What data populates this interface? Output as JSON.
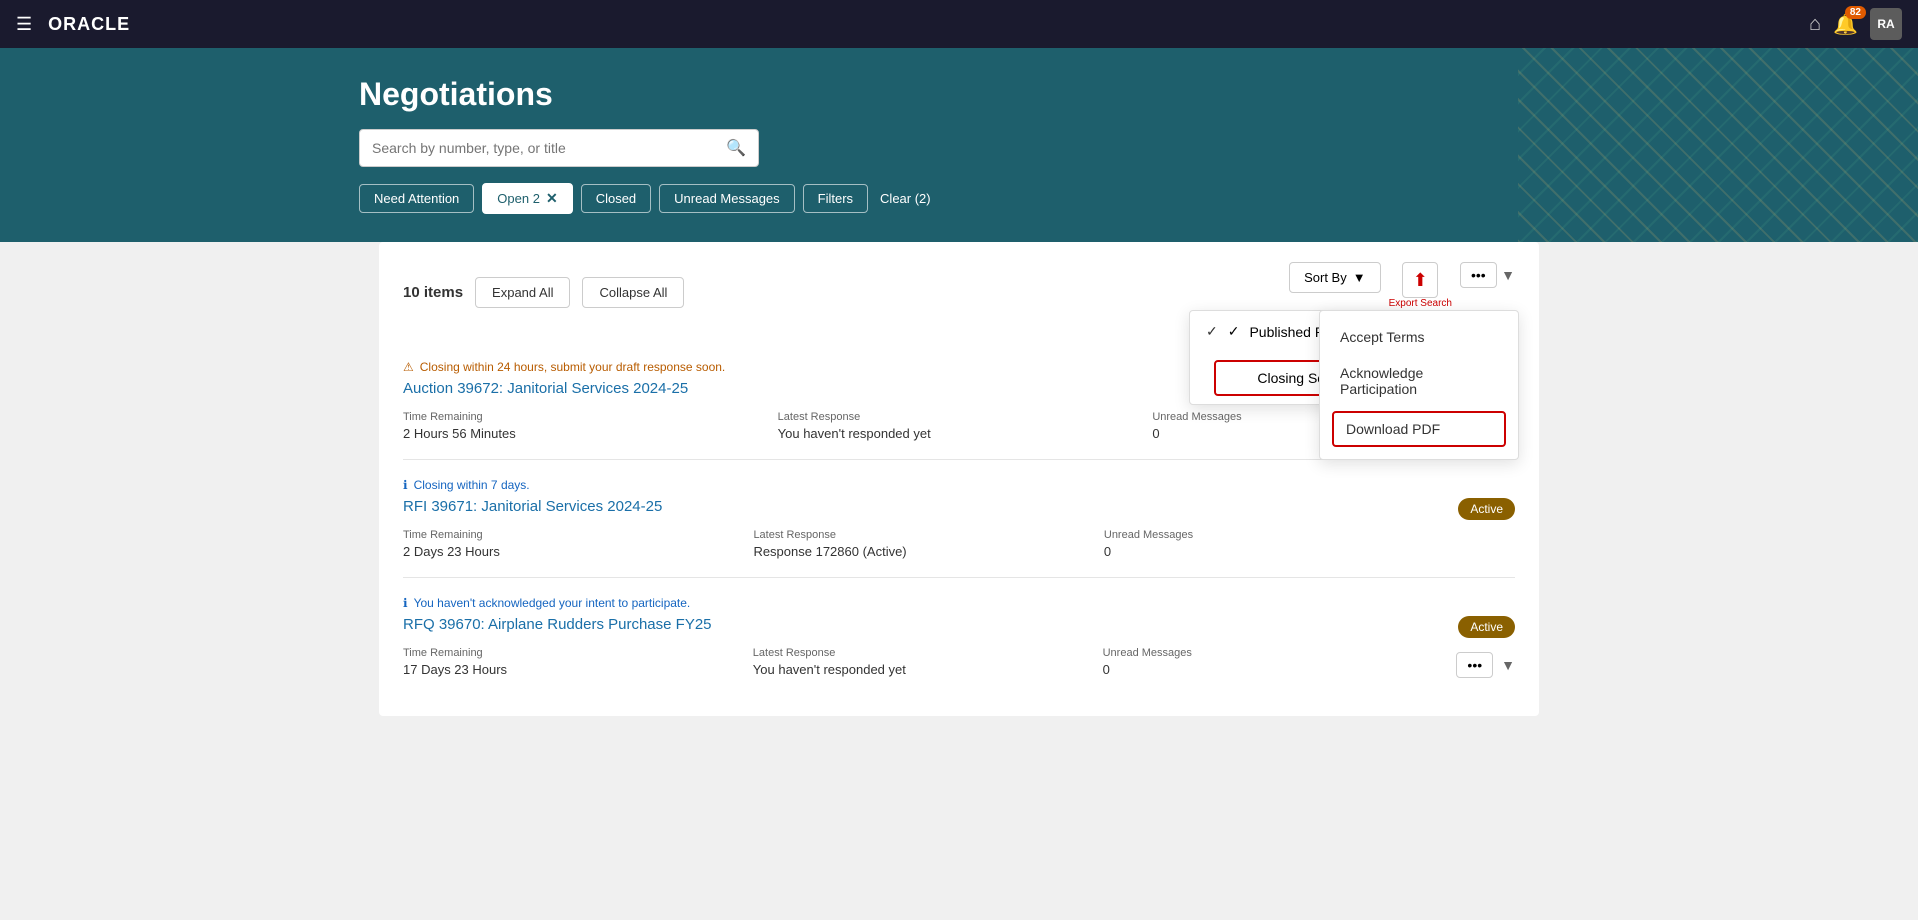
{
  "topnav": {
    "hamburger": "☰",
    "logo": "ORACLE",
    "home_icon": "⌂",
    "notif_count": "82",
    "user_initials": "RA"
  },
  "hero": {
    "title": "Negotiations",
    "search_placeholder": "Search by number, type, or title",
    "filters": [
      {
        "id": "need_attention",
        "label": "Need Attention",
        "active": false
      },
      {
        "id": "open",
        "label": "Open 2",
        "active": true,
        "closeable": true
      },
      {
        "id": "closed",
        "label": "Closed",
        "active": false
      },
      {
        "id": "unread",
        "label": "Unread Messages",
        "active": false
      },
      {
        "id": "filters",
        "label": "Filters",
        "active": false
      }
    ],
    "clear_label": "Clear (2)"
  },
  "content": {
    "items_count": "10 items",
    "expand_all_label": "Expand All",
    "collapse_all_label": "Collapse All",
    "sort_by_label": "Sort By",
    "sort_options": [
      {
        "id": "published",
        "label": "Published Recently",
        "selected": true
      },
      {
        "id": "closing",
        "label": "Closing Soon",
        "selected": false,
        "highlighted": true
      }
    ],
    "export_label": "Export Search\nResults",
    "actions_dropdown": [
      {
        "id": "accept_terms",
        "label": "Accept Terms"
      },
      {
        "id": "acknowledge",
        "label": "Acknowledge Participation"
      },
      {
        "id": "download_pdf",
        "label": "Download PDF",
        "highlighted": true
      }
    ]
  },
  "negotiations": [
    {
      "id": "neg1",
      "alert_type": "warning",
      "alert_icon": "⚠",
      "alert_text": "Closing within 24 hours, submit your draft response soon.",
      "title": "Auction 39672: Janitorial Services 2024-25",
      "time_remaining_label": "Time Remaining",
      "time_remaining_value": "2 Hours 56 Minutes",
      "latest_response_label": "Latest Response",
      "latest_response_value": "You haven't responded yet",
      "unread_label": "Unread Messages",
      "unread_value": "0",
      "status": null
    },
    {
      "id": "neg2",
      "alert_type": "info",
      "alert_icon": "ℹ",
      "alert_text": "Closing within 7 days.",
      "title": "RFI 39671: Janitorial Services 2024-25",
      "time_remaining_label": "Time Remaining",
      "time_remaining_value": "2 Days 23 Hours",
      "latest_response_label": "Latest Response",
      "latest_response_value": "Response 172860 (Active)",
      "unread_label": "Unread Messages",
      "unread_value": "0",
      "status": "Active"
    },
    {
      "id": "neg3",
      "alert_type": "info",
      "alert_icon": "ℹ",
      "alert_text": "You haven't acknowledged your intent to participate.",
      "title": "RFQ 39670: Airplane Rudders Purchase FY25",
      "time_remaining_label": "Time Remaining",
      "time_remaining_value": "17 Days 23 Hours",
      "latest_response_label": "Latest Response",
      "latest_response_value": "You haven't responded yet",
      "unread_label": "Unread Messages",
      "unread_value": "0",
      "status": "Active"
    }
  ]
}
